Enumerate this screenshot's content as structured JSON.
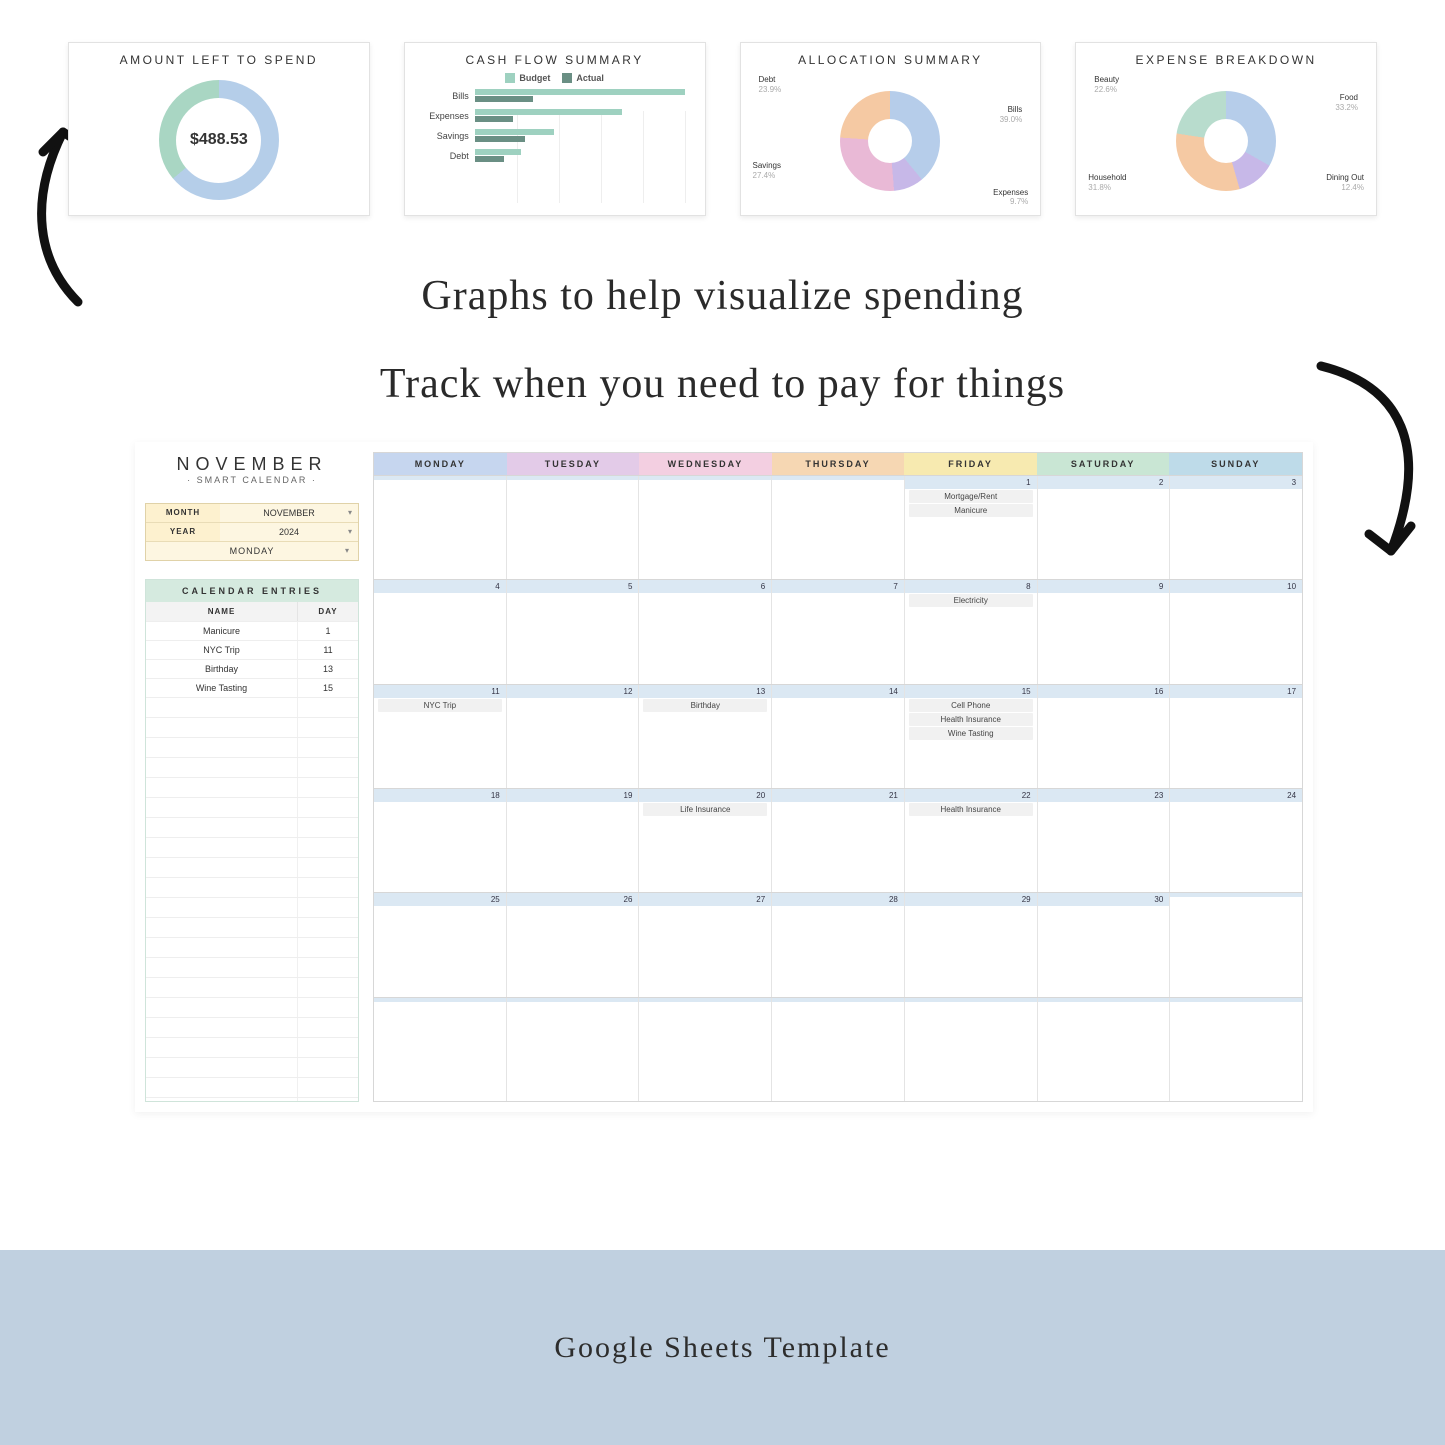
{
  "thumbs": {
    "t1": {
      "title": "AMOUNT LEFT TO SPEND",
      "value": "$488.53"
    },
    "t2": {
      "title": "CASH FLOW SUMMARY",
      "legend_budget": "Budget",
      "legend_actual": "Actual",
      "rows": [
        "Bills",
        "Expenses",
        "Savings",
        "Debt"
      ]
    },
    "t3": {
      "title": "ALLOCATION SUMMARY"
    },
    "t4": {
      "title": "EXPENSE BREAKDOWN"
    }
  },
  "chart_data": [
    {
      "type": "gauge",
      "title": "AMOUNT LEFT TO SPEND",
      "value": 488.53,
      "display": "$488.53",
      "spent_vs_remaining": {
        "spent_pct": 64,
        "remaining_pct": 36
      }
    },
    {
      "type": "bar",
      "title": "CASH FLOW SUMMARY",
      "orientation": "horizontal",
      "categories": [
        "Bills",
        "Expenses",
        "Savings",
        "Debt"
      ],
      "series": [
        {
          "name": "Budget",
          "color": "#9ed1c0",
          "values": [
            100,
            70,
            38,
            22
          ]
        },
        {
          "name": "Actual",
          "color": "#6a8f84",
          "values": [
            28,
            18,
            24,
            14
          ]
        }
      ],
      "xlim": [
        0,
        100
      ],
      "note": "values are relative percent-of-max estimated from bar lengths"
    },
    {
      "type": "pie",
      "title": "ALLOCATION SUMMARY",
      "slices": [
        {
          "name": "Bills",
          "pct": 39.0,
          "color": "#b6cdea"
        },
        {
          "name": "Savings",
          "pct": 27.4,
          "color": "#e9b9d6"
        },
        {
          "name": "Debt",
          "pct": 23.9,
          "color": "#f5c9a3"
        },
        {
          "name": "Expenses",
          "pct": 9.7,
          "color": "#c7b8e8"
        }
      ]
    },
    {
      "type": "pie",
      "title": "EXPENSE BREAKDOWN",
      "slices": [
        {
          "name": "Food",
          "pct": 33.2,
          "color": "#b6cdea"
        },
        {
          "name": "Household",
          "pct": 31.8,
          "color": "#f5c9a3"
        },
        {
          "name": "Beauty",
          "pct": 22.6,
          "color": "#b8dccd"
        },
        {
          "name": "Dining Out",
          "pct": 12.4,
          "color": "#c7b8e8"
        }
      ]
    }
  ],
  "donut3": {
    "debt": {
      "name": "Debt",
      "pct": "23.9%"
    },
    "bills": {
      "name": "Bills",
      "pct": "39.0%"
    },
    "savings": {
      "name": "Savings",
      "pct": "27.4%"
    },
    "expenses": {
      "name": "Expenses",
      "pct": "9.7%"
    }
  },
  "donut4": {
    "beauty": {
      "name": "Beauty",
      "pct": "22.6%"
    },
    "food": {
      "name": "Food",
      "pct": "33.2%"
    },
    "household": {
      "name": "Household",
      "pct": "31.8%"
    },
    "dining": {
      "name": "Dining Out",
      "pct": "12.4%"
    }
  },
  "headline1": "Graphs to help visualize spending",
  "headline2": "Track when you need to pay for things",
  "calendar": {
    "title": "NOVEMBER",
    "subtitle": "· SMART CALENDAR ·",
    "month_label": "MONTH",
    "month_value": "NOVEMBER",
    "year_label": "YEAR",
    "year_value": "2024",
    "start_day": "MONDAY",
    "entries_header": "CALENDAR ENTRIES",
    "entries_name_col": "NAME",
    "entries_day_col": "DAY",
    "entries": [
      {
        "name": "Manicure",
        "day": "1"
      },
      {
        "name": "NYC Trip",
        "day": "11"
      },
      {
        "name": "Birthday",
        "day": "13"
      },
      {
        "name": "Wine Tasting",
        "day": "15"
      }
    ],
    "days": [
      "MONDAY",
      "TUESDAY",
      "WEDNESDAY",
      "THURSDAY",
      "FRIDAY",
      "SATURDAY",
      "SUNDAY"
    ],
    "day_colors": [
      "#c6d6ef",
      "#e3cbe8",
      "#f3cfe1",
      "#f6d7b3",
      "#f7eab0",
      "#c9e6d4",
      "#bedbe9"
    ],
    "weeks": [
      [
        {
          "n": "",
          "ev": []
        },
        {
          "n": "",
          "ev": []
        },
        {
          "n": "",
          "ev": []
        },
        {
          "n": "",
          "ev": []
        },
        {
          "n": "1",
          "ev": [
            "Mortgage/Rent",
            "Manicure"
          ]
        },
        {
          "n": "2",
          "ev": []
        },
        {
          "n": "3",
          "ev": []
        }
      ],
      [
        {
          "n": "4",
          "ev": []
        },
        {
          "n": "5",
          "ev": []
        },
        {
          "n": "6",
          "ev": []
        },
        {
          "n": "7",
          "ev": []
        },
        {
          "n": "8",
          "ev": [
            "Electricity"
          ]
        },
        {
          "n": "9",
          "ev": []
        },
        {
          "n": "10",
          "ev": []
        }
      ],
      [
        {
          "n": "11",
          "ev": [
            "NYC Trip"
          ]
        },
        {
          "n": "12",
          "ev": []
        },
        {
          "n": "13",
          "ev": [
            "Birthday"
          ]
        },
        {
          "n": "14",
          "ev": []
        },
        {
          "n": "15",
          "ev": [
            "Cell Phone",
            "Health Insurance",
            "Wine Tasting"
          ]
        },
        {
          "n": "16",
          "ev": []
        },
        {
          "n": "17",
          "ev": []
        }
      ],
      [
        {
          "n": "18",
          "ev": []
        },
        {
          "n": "19",
          "ev": []
        },
        {
          "n": "20",
          "ev": [
            "Life Insurance"
          ]
        },
        {
          "n": "21",
          "ev": []
        },
        {
          "n": "22",
          "ev": [
            "Health Insurance"
          ]
        },
        {
          "n": "23",
          "ev": []
        },
        {
          "n": "24",
          "ev": []
        }
      ],
      [
        {
          "n": "25",
          "ev": []
        },
        {
          "n": "26",
          "ev": []
        },
        {
          "n": "27",
          "ev": []
        },
        {
          "n": "28",
          "ev": []
        },
        {
          "n": "29",
          "ev": []
        },
        {
          "n": "30",
          "ev": []
        },
        {
          "n": "",
          "ev": []
        }
      ],
      [
        {
          "n": "",
          "ev": []
        },
        {
          "n": "",
          "ev": []
        },
        {
          "n": "",
          "ev": []
        },
        {
          "n": "",
          "ev": []
        },
        {
          "n": "",
          "ev": []
        },
        {
          "n": "",
          "ev": []
        },
        {
          "n": "",
          "ev": []
        }
      ]
    ]
  },
  "footer": "Google Sheets Template"
}
